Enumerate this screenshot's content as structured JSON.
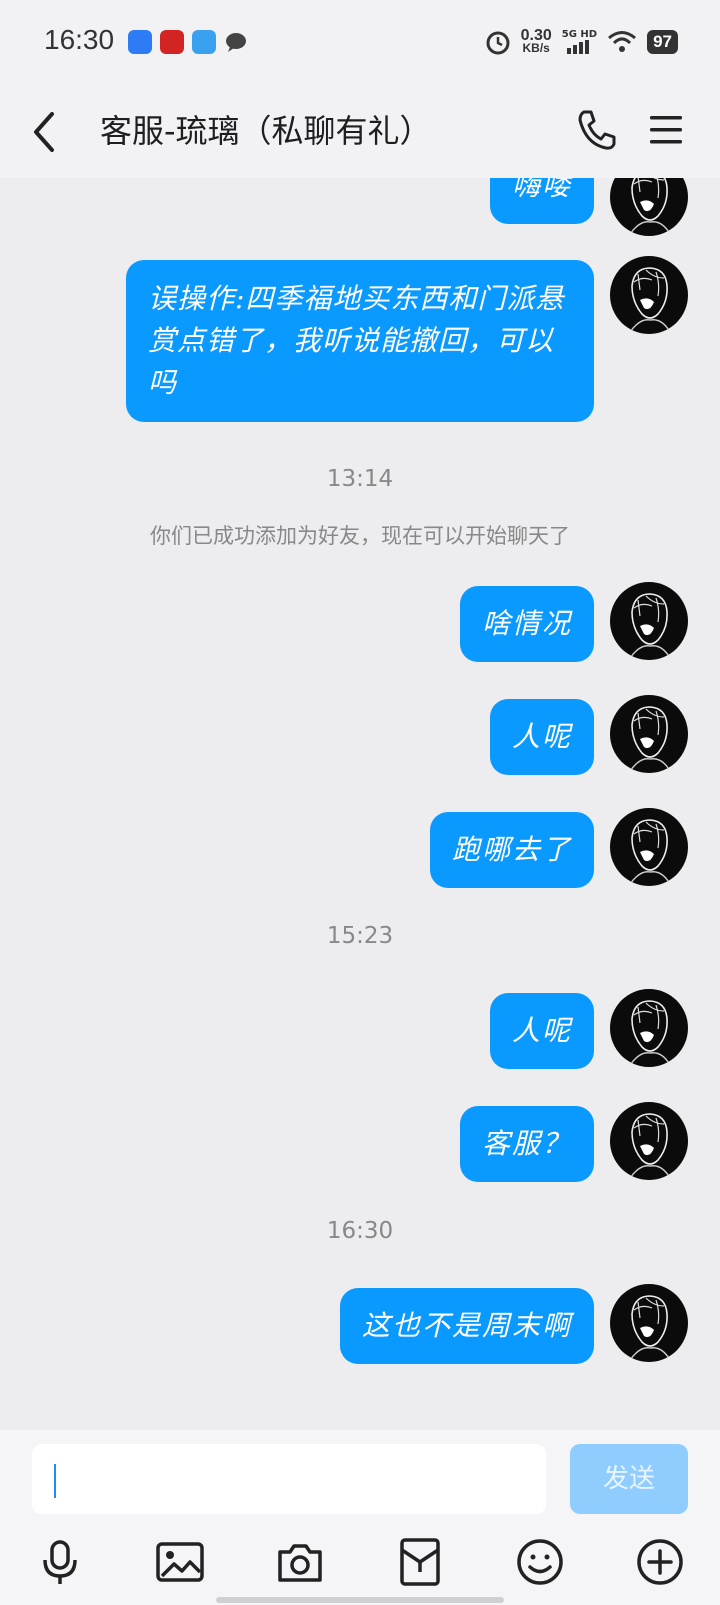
{
  "status_bar": {
    "time": "16:30",
    "net_speed": "0.30",
    "net_unit": "KB/s",
    "signal_label": "5G HD",
    "battery": "97"
  },
  "header": {
    "title": "客服-琉璃（私聊有礼）",
    "icons": [
      "back-icon",
      "phone-icon",
      "menu-icon"
    ]
  },
  "messages": [
    {
      "text": "嗨喽"
    },
    {
      "text": "误操作:四季福地买东西和门派悬赏点错了，我听说能撤回，可以吗"
    },
    {
      "timestamp": "13:14"
    },
    {
      "system": "你们已成功添加为好友，现在可以开始聊天了"
    },
    {
      "text": "啥情况"
    },
    {
      "text": "人呢"
    },
    {
      "text": "跑哪去了"
    },
    {
      "timestamp": "15:23"
    },
    {
      "text": "人呢"
    },
    {
      "text": "客服？"
    },
    {
      "timestamp": "16:30"
    },
    {
      "text": "这也不是周末啊"
    }
  ],
  "input": {
    "value": "",
    "send_label": "发送"
  },
  "toolbar": [
    "mic-icon",
    "image-icon",
    "camera-icon",
    "red-packet-icon",
    "emoji-icon",
    "plus-icon"
  ],
  "colors": {
    "bubble": "#0a99ff",
    "background": "#ededf0",
    "send_disabled": "#8fccff"
  }
}
